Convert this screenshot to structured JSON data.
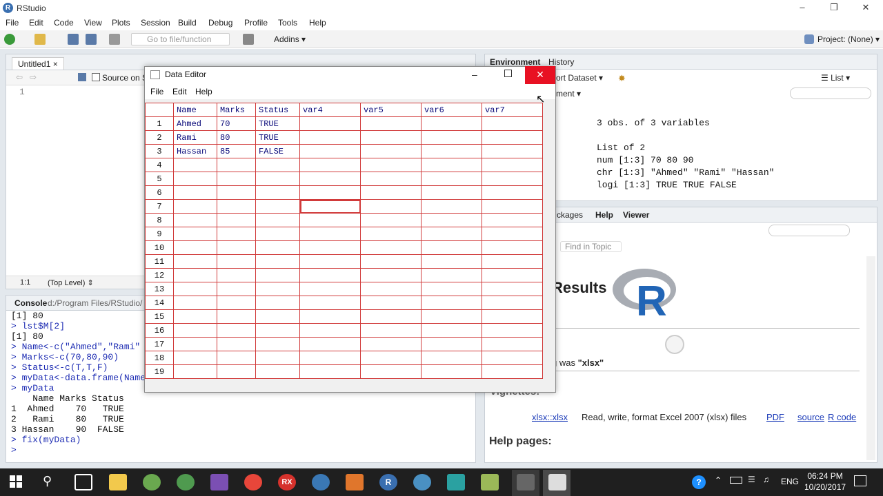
{
  "app": {
    "title": "RStudio",
    "project": "Project: (None)"
  },
  "menubar": [
    "File",
    "Edit",
    "Code",
    "View",
    "Plots",
    "Session",
    "Build",
    "Debug",
    "Profile",
    "Tools",
    "Help"
  ],
  "toolbar": {
    "goto_placeholder": "Go to file/function",
    "addins": "Addins"
  },
  "editor": {
    "tab": "Untitled1",
    "source_on_save": "Source on S",
    "line_number": "1",
    "position": "1:1",
    "scope": "(Top Level)"
  },
  "console": {
    "tab": "Console",
    "path": "d:/Program Files/RStudio/",
    "lines": [
      {
        "text": "[1] 80",
        "kind": "out"
      },
      {
        "text": "> lst$M[2]",
        "kind": "prompt"
      },
      {
        "text": "[1] 80",
        "kind": "out"
      },
      {
        "text": "> Name<-c(\"Ahmed\",\"Rami\"",
        "kind": "prompt"
      },
      {
        "text": "> Marks<-c(70,80,90)",
        "kind": "prompt"
      },
      {
        "text": "> Status<-c(T,T,F)",
        "kind": "prompt"
      },
      {
        "text": "> myData<-data.frame(Name",
        "kind": "prompt"
      },
      {
        "text": "> myData",
        "kind": "prompt"
      },
      {
        "text": "    Name Marks Status",
        "kind": "out"
      },
      {
        "text": "1  Ahmed    70   TRUE",
        "kind": "out"
      },
      {
        "text": "2   Rami    80   TRUE",
        "kind": "out"
      },
      {
        "text": "3 Hassan    90  FALSE",
        "kind": "out"
      },
      {
        "text": "> fix(myData)",
        "kind": "prompt"
      },
      {
        "text": ">",
        "kind": "prompt"
      }
    ]
  },
  "environment": {
    "tabs": [
      "Environment",
      "History"
    ],
    "import_dataset": "ort Dataset",
    "global": "ment",
    "list_view": "List",
    "lines": [
      "3 obs. of 3 variables",
      "",
      "List of 2",
      "num [1:3] 70 80 90",
      "chr [1:3] \"Ahmed\" \"Rami\" \"Hassan\"",
      "logi [1:3] TRUE TRUE FALSE"
    ]
  },
  "help": {
    "tabs": [
      "ckages",
      "Help",
      "Viewer"
    ],
    "find_placeholder": "Find in Topic",
    "heading": "Results",
    "was_text": "g was ",
    "was_bold": "\"xlsx\"",
    "vignettes": "Vignettes:",
    "link_name": "xlsx::xlsx",
    "link_desc": "Read, write, format Excel 2007 (xlsx) files",
    "pdf": "PDF",
    "source": "source",
    "rcode": "R code",
    "help_pages": "Help pages:"
  },
  "data_editor": {
    "title": "Data Editor",
    "menu": [
      "File",
      "Edit",
      "Help"
    ],
    "columns": [
      "Name",
      "Marks",
      "Status",
      "var4",
      "var5",
      "var6",
      "var7"
    ],
    "rows": [
      [
        "Ahmed",
        "70",
        "TRUE"
      ],
      [
        "Rami",
        "80",
        "TRUE"
      ],
      [
        "Hassan",
        "85",
        "FALSE"
      ]
    ],
    "row_count": 19,
    "selected_row": 7,
    "selected_col": 4
  },
  "taskbar": {
    "language": "ENG",
    "time": "06:24 PM",
    "date": "10/20/2017"
  },
  "colors": {
    "accent_red": "#e81123",
    "grid_red": "#d13a3a",
    "r_blue": "#3a6fb0"
  }
}
